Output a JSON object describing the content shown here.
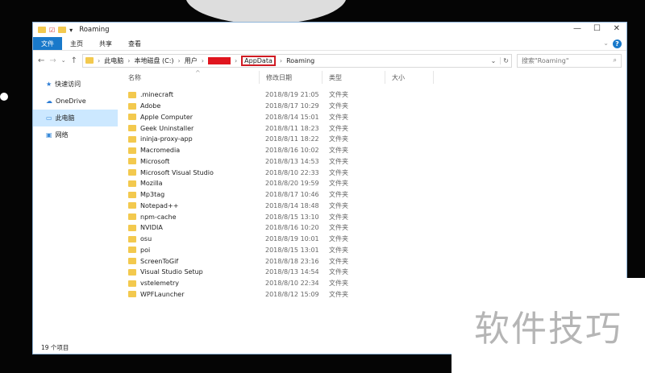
{
  "window": {
    "title": "Roaming",
    "minimize": "—",
    "maximize": "☐",
    "close": "✕",
    "help": "?"
  },
  "ribbon": {
    "tabs": [
      "文件",
      "主页",
      "共享",
      "查看"
    ]
  },
  "address": {
    "crumbs": [
      "此电脑",
      "本地磁盘 (C:)",
      "用户"
    ],
    "highlighted": "AppData",
    "current": "Roaming",
    "search_placeholder": "搜索\"Roaming\""
  },
  "sidebar": {
    "items": [
      "快速访问",
      "OneDrive",
      "此电脑",
      "网络"
    ]
  },
  "columns": {
    "name": "名称",
    "date": "修改日期",
    "type": "类型",
    "size": "大小"
  },
  "files": [
    {
      "name": ".minecraft",
      "date": "2018/8/19 21:05",
      "type": "文件夹"
    },
    {
      "name": "Adobe",
      "date": "2018/8/17 10:29",
      "type": "文件夹"
    },
    {
      "name": "Apple Computer",
      "date": "2018/8/14 15:01",
      "type": "文件夹"
    },
    {
      "name": "Geek Uninstaller",
      "date": "2018/8/11 18:23",
      "type": "文件夹"
    },
    {
      "name": "ininja-proxy-app",
      "date": "2018/8/11 18:22",
      "type": "文件夹"
    },
    {
      "name": "Macromedia",
      "date": "2018/8/16 10:02",
      "type": "文件夹"
    },
    {
      "name": "Microsoft",
      "date": "2018/8/13 14:53",
      "type": "文件夹"
    },
    {
      "name": "Microsoft Visual Studio",
      "date": "2018/8/10 22:33",
      "type": "文件夹"
    },
    {
      "name": "Mozilla",
      "date": "2018/8/20 19:59",
      "type": "文件夹"
    },
    {
      "name": "Mp3tag",
      "date": "2018/8/17 10:46",
      "type": "文件夹"
    },
    {
      "name": "Notepad++",
      "date": "2018/8/14 18:48",
      "type": "文件夹"
    },
    {
      "name": "npm-cache",
      "date": "2018/8/15 13:10",
      "type": "文件夹"
    },
    {
      "name": "NVIDIA",
      "date": "2018/8/16 10:20",
      "type": "文件夹"
    },
    {
      "name": "osu",
      "date": "2018/8/19 10:01",
      "type": "文件夹"
    },
    {
      "name": "poi",
      "date": "2018/8/15 13:01",
      "type": "文件夹"
    },
    {
      "name": "ScreenToGif",
      "date": "2018/8/18 23:16",
      "type": "文件夹"
    },
    {
      "name": "Visual Studio Setup",
      "date": "2018/8/13 14:54",
      "type": "文件夹"
    },
    {
      "name": "vstelemetry",
      "date": "2018/8/10 22:34",
      "type": "文件夹"
    },
    {
      "name": "WPFLauncher",
      "date": "2018/8/12 15:09",
      "type": "文件夹"
    }
  ],
  "status": "19 个项目",
  "watermark": "软件技巧"
}
